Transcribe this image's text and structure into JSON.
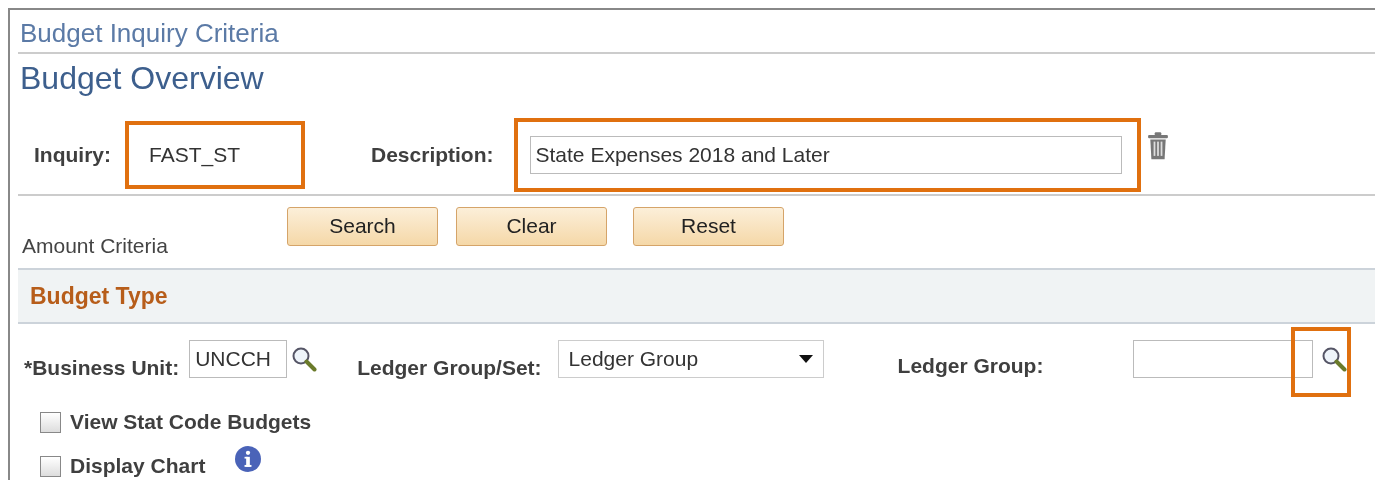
{
  "breadcrumb": "Budget Inquiry Criteria",
  "page_title": "Budget Overview",
  "inquiry": {
    "label": "Inquiry:",
    "value": "FAST_ST",
    "highlighted": true
  },
  "description": {
    "label": "Description:",
    "value": "State Expenses 2018 and Later",
    "highlighted": true
  },
  "amount_criteria": "Amount Criteria",
  "buttons": [
    "Search",
    "Clear",
    "Reset"
  ],
  "section": {
    "title": "Budget Type"
  },
  "business_unit": {
    "label": "*Business Unit:",
    "value": "UNCCH"
  },
  "ledger_group_set": {
    "label": "Ledger Group/Set:",
    "value": "Ledger Group"
  },
  "ledger_group": {
    "label": "Ledger Group:",
    "lookup_highlighted": true
  },
  "checkboxes": [
    {
      "label": "View Stat Code Budgets",
      "checked": false,
      "info": false
    },
    {
      "label": "Display Chart",
      "checked": false,
      "info": true
    }
  ]
}
